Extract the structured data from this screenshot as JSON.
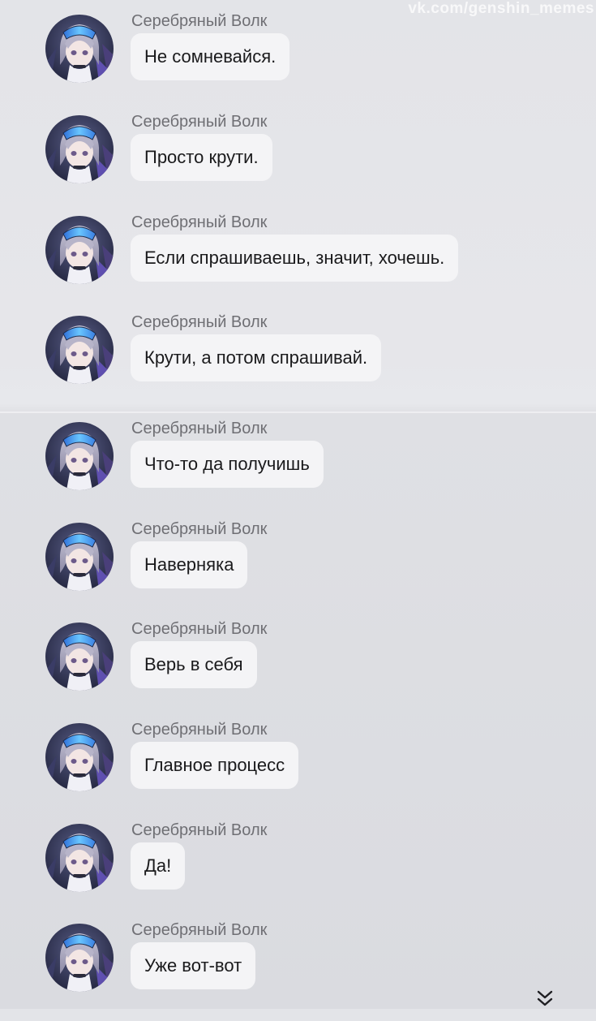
{
  "watermark": "vk.com/genshin_memes",
  "colors": {
    "bubble": "#f4f4f6",
    "sender": "#6f6f74",
    "text": "#1a1a1c"
  },
  "messages": [
    {
      "sender": "Серебряный Волк",
      "text": "Не сомневайся."
    },
    {
      "sender": "Серебряный Волк",
      "text": "Просто крути."
    },
    {
      "sender": "Серебряный Волк",
      "text": "Если спрашиваешь, значит, хочешь."
    },
    {
      "sender": "Серебряный Волк",
      "text": "Крути, а потом спрашивай."
    },
    {
      "sender": "Серебряный Волк",
      "text": "Что-то да получишь"
    },
    {
      "sender": "Серебряный Волк",
      "text": "Наверняка"
    },
    {
      "sender": "Серебряный Волк",
      "text": "Верь в себя"
    },
    {
      "sender": "Серебряный Волк",
      "text": "Главное процесс"
    },
    {
      "sender": "Серебряный Волк",
      "text": "Да!"
    },
    {
      "sender": "Серебряный Волк",
      "text": "Уже вот-вот"
    }
  ],
  "icons": {
    "avatar": "silver-wolf-avatar",
    "scroll": "double-chevron-down-icon"
  }
}
